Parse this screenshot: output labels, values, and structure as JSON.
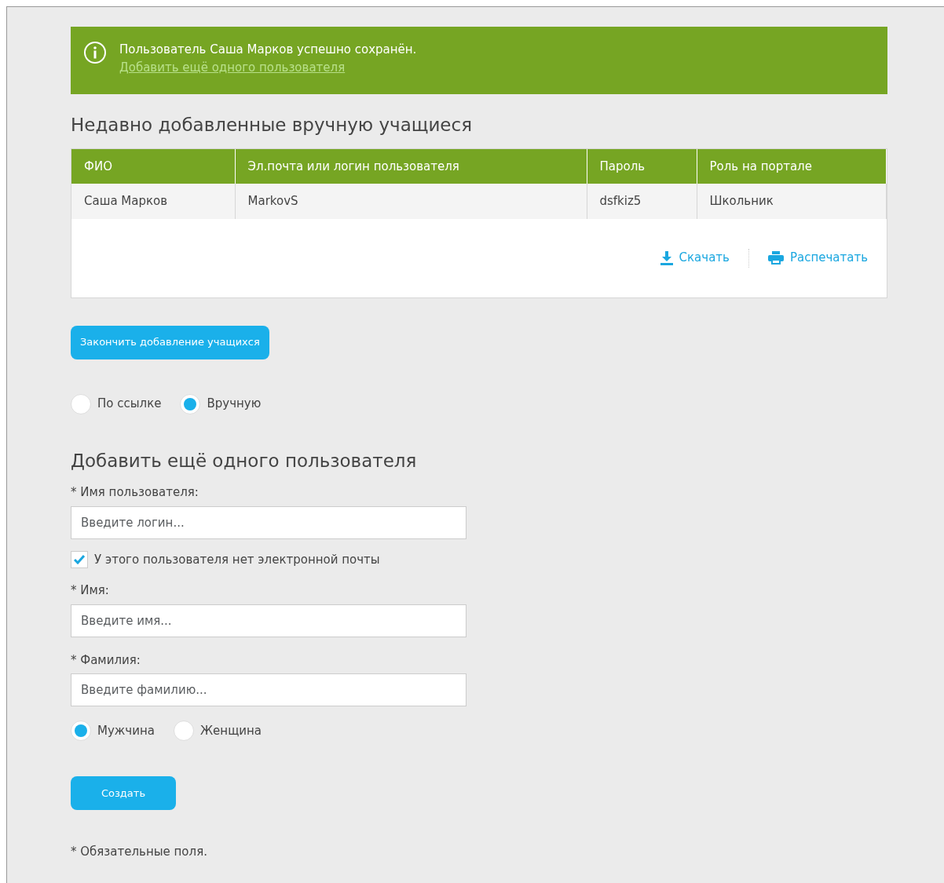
{
  "alert": {
    "message": "Пользователь Саша Марков успешно сохранён.",
    "link": "Добавить ещё одного пользователя"
  },
  "recent": {
    "title": "Недавно добавленные вручную учащиеся",
    "table": {
      "columns": [
        "ФИО",
        "Эл.почта или логин пользователя",
        "Пароль",
        "Роль на портале"
      ],
      "rows": [
        [
          "Саша Марков",
          "MarkovS",
          "dsfkiz5",
          "Школьник"
        ]
      ]
    },
    "actions": [
      {
        "kind": "download",
        "label": "Скачать"
      },
      {
        "kind": "print",
        "label": "Распечатать"
      }
    ]
  },
  "finish_button": "Закончить добавление учащихся",
  "mode": [
    {
      "label": "По ссылке",
      "selected": false
    },
    {
      "label": "Вручную",
      "selected": true
    }
  ],
  "form": {
    "title": "Добавить ещё одного пользователя",
    "items": [
      {
        "kind": "field",
        "label": "* Имя пользователя:",
        "placeholder": "Введите логин..."
      },
      {
        "kind": "checkbox",
        "label": "У этого пользователя нет электронной почты",
        "checked": true
      },
      {
        "kind": "field",
        "label": "* Имя:",
        "placeholder": "Введите имя..."
      },
      {
        "kind": "field",
        "label": "* Фамилия:",
        "placeholder": "Введите фамилию..."
      }
    ],
    "gender": [
      {
        "label": "Мужчина",
        "selected": true
      },
      {
        "label": "Женщина",
        "selected": false
      }
    ],
    "submit": "Создать",
    "footnote": "* Обязательные поля."
  }
}
